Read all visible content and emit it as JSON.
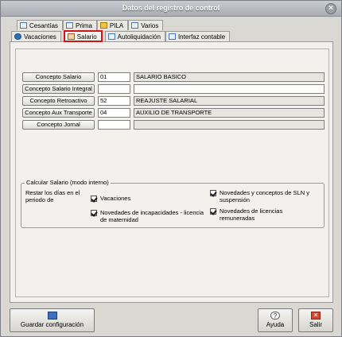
{
  "window": {
    "title": "Datos del registro de control",
    "close_glyph": "×"
  },
  "tabs_top": [
    {
      "label": "Cesantías",
      "icon": "cesantias-icon"
    },
    {
      "label": "Prima",
      "icon": "prima-icon"
    },
    {
      "label": "PILA",
      "icon": "pila-icon"
    },
    {
      "label": "Varios",
      "icon": "varios-icon"
    }
  ],
  "tabs_bottom": [
    {
      "label": "Vacaciones",
      "icon": "vacaciones-icon"
    },
    {
      "label": "Salario",
      "icon": "salario-icon",
      "active": true
    },
    {
      "label": "Autoliquidación",
      "icon": "autoliquidacion-icon"
    },
    {
      "label": "Interfaz contable",
      "icon": "interfaz-icon"
    }
  ],
  "concepts": [
    {
      "button": "Concepto Salario",
      "code": "01",
      "description": "SALARIO BASICO"
    },
    {
      "button": "Concepto Salario Integral",
      "code": "",
      "description": ""
    },
    {
      "button": "Concepto Retroactivo",
      "code": "52",
      "description": "REAJUSTE SALARIAL"
    },
    {
      "button": "Concepto Aux Transporte",
      "code": "04",
      "description": "AUXILIO DE TRANSPORTE"
    },
    {
      "button": "Concepto Jornal",
      "code": "",
      "description": ""
    }
  ],
  "calc_group": {
    "title": "Calcular Salario (modo interno)",
    "restar_label": "Restar los días en el periodo de",
    "checks": [
      {
        "label": "Vacaciones",
        "checked": true
      },
      {
        "label": "Novedades de incapacidades - licencia de maternidad",
        "checked": true
      },
      {
        "label": "Novedades y conceptos de SLN y suspensión",
        "checked": true
      },
      {
        "label": "Novedades de licencias remuneradas",
        "checked": true
      }
    ]
  },
  "footer": {
    "save_label": "Guardar configuración",
    "help_label": "Ayuda",
    "exit_label": "Salir",
    "help_glyph": "?",
    "exit_glyph": "✕"
  }
}
